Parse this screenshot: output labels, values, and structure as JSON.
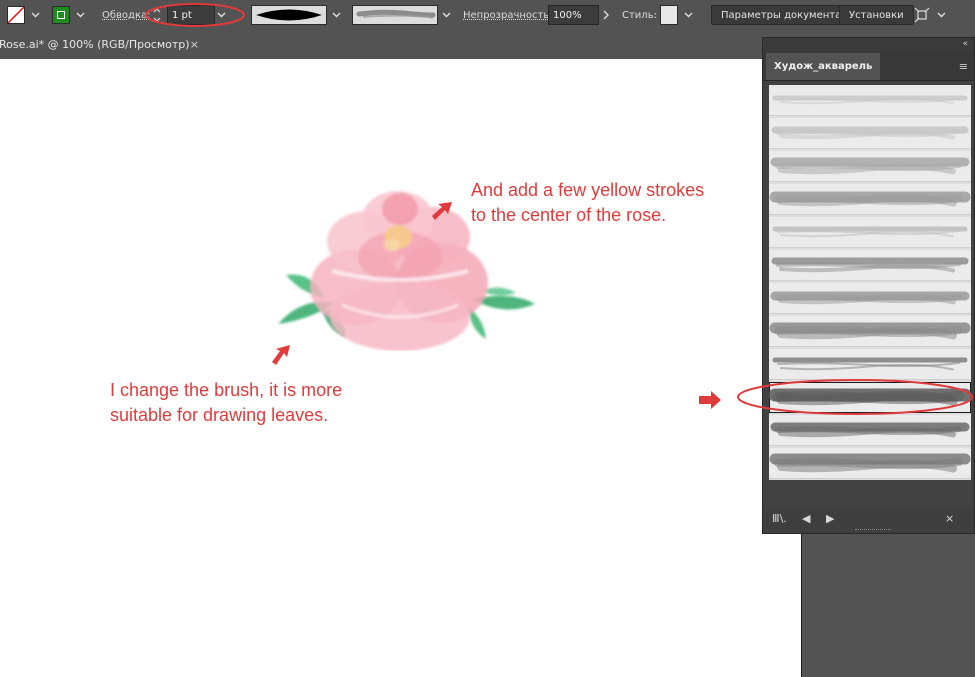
{
  "toolbar": {
    "stroke_label": "Обводка:",
    "stroke_weight": "1 pt",
    "opacity_label": "Непрозрачность:",
    "opacity_value": "100%",
    "style_label": "Стиль:",
    "doc_settings_button": "Параметры документа",
    "preferences_button": "Установки"
  },
  "document_tab": {
    "title": "Rose.ai* @ 100% (RGB/Просмотр)",
    "close": "×"
  },
  "artboard": {
    "note_top": [
      "And add a few yellow strokes",
      "to the center of the rose."
    ],
    "note_bottom": [
      "I change the brush, it is more",
      "suitable for drawing leaves."
    ]
  },
  "brush_panel": {
    "tab_label": "Худож_акварель",
    "selected_index": 9,
    "brushes": [
      {
        "name": "watercolor-brush-1",
        "color": "#c8c8c8"
      },
      {
        "name": "watercolor-brush-2",
        "color": "#c4c4c4"
      },
      {
        "name": "watercolor-brush-3",
        "color": "#a8a8a8"
      },
      {
        "name": "watercolor-brush-4",
        "color": "#9c9c9c"
      },
      {
        "name": "watercolor-brush-5",
        "color": "#bcbcbc"
      },
      {
        "name": "watercolor-brush-6",
        "color": "#8e8e8e"
      },
      {
        "name": "watercolor-brush-7",
        "color": "#9a9a9a"
      },
      {
        "name": "watercolor-brush-8",
        "color": "#8a8a8a"
      },
      {
        "name": "watercolor-brush-9",
        "color": "#7e7e7e"
      },
      {
        "name": "watercolor-brush-10",
        "color": "#5a5a5a"
      },
      {
        "name": "watercolor-brush-11",
        "color": "#6a6a6a"
      },
      {
        "name": "watercolor-brush-12",
        "color": "#7a7a7a"
      }
    ]
  },
  "colors": {
    "annotation_red": "#e03b3b",
    "rose_pink": "#f4a7b5",
    "leaf_green": "#2fa866",
    "rose_center_yellow": "#f7c98b"
  }
}
